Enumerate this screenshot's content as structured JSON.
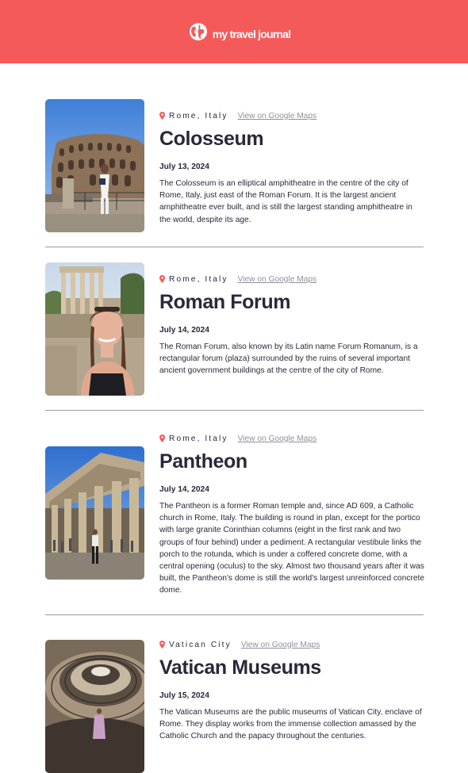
{
  "navbar": {
    "brand_text": "my travel journal",
    "icon": "globe-icon",
    "background": "#f55a5a"
  },
  "entries": [
    {
      "location": "Rome, Italy",
      "maps_link": "View on Google Maps",
      "title": "Colosseum",
      "date": "July 13, 2024",
      "description": "The Colosseum is an elliptical amphitheatre in the centre of the city of Rome, Italy, just east of the Roman Forum. It is the largest ancient amphitheatre ever built, and is still the largest standing amphitheatre in the world, despite its age."
    },
    {
      "location": "Rome, Italy",
      "maps_link": "View on Google Maps",
      "title": "Roman Forum",
      "date": "July 14, 2024",
      "description": "The Roman Forum, also known by its Latin name Forum Romanum, is a rectangular forum (plaza) surrounded by the ruins of several important ancient government buildings at the centre of the city of Rome."
    },
    {
      "location": "Rome, Italy",
      "maps_link": "View on Google Maps",
      "title": "Pantheon",
      "date": "July 14, 2024",
      "description": "The Pantheon is a former Roman temple and, since AD 609, a Catholic church in Rome, Italy. The building is round in plan, except for the portico with large granite Corinthian columns (eight in the first rank and two groups of four behind) under a pediment. A rectangular vestibule links the porch to the rotunda, which is under a coffered concrete dome, with a central opening (oculus) to the sky. Almost two thousand years after it was built, the Pantheon's dome is still the world's largest unreinforced concrete dome."
    },
    {
      "location": "Vatican City",
      "maps_link": "View on Google Maps",
      "title": "Vatican Museums",
      "date": "July 15, 2024",
      "description": "The Vatican Museums are the public museums of Vatican City, enclave of Rome. They display works from the immense collection amassed by the Catholic Church and the papacy throughout the centuries."
    }
  ],
  "colors": {
    "accent": "#f55a5a",
    "text": "#2b283a",
    "muted": "#918e9b"
  }
}
